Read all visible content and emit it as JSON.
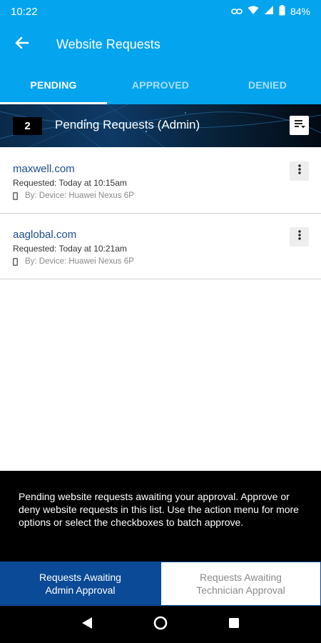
{
  "status_bar": {
    "time": "10:22",
    "battery": "84%"
  },
  "app_bar": {
    "title": "Website Requests"
  },
  "tabs": [
    {
      "label": "PENDING",
      "active": true
    },
    {
      "label": "APPROVED",
      "active": false
    },
    {
      "label": "DENIED",
      "active": false
    }
  ],
  "banner": {
    "count": "2",
    "title": "Pending Requests (Admin)"
  },
  "requests": [
    {
      "url": "maxwell.com",
      "requested": "Requested: Today at 10:15am",
      "device": "By: Device: Huawei Nexus 6P"
    },
    {
      "url": "aaglobal.com",
      "requested": "Requested: Today at 10:21am",
      "device": "By: Device: Huawei Nexus 6P"
    }
  ],
  "info": {
    "text": "Pending website requests awaiting your approval. Approve or deny website requests in this list. Use the action menu for more options or select the checkboxes to batch approve."
  },
  "bottom_tabs": [
    {
      "label": "Requests Awaiting Admin Approval",
      "active": true
    },
    {
      "label": "Requests Awaiting Technician Approval",
      "active": false
    }
  ],
  "colors": {
    "primary": "#05a4ef",
    "dark_blue": "#0a4a96",
    "link": "#1f4b8e"
  },
  "icons": [
    "back-arrow-icon",
    "sort-list-icon",
    "more-vert-icon",
    "phone-icon",
    "nav-back-icon",
    "nav-home-icon",
    "nav-recents-icon",
    "wifi-icon",
    "signal-icon",
    "battery-icon",
    "link-icon"
  ]
}
